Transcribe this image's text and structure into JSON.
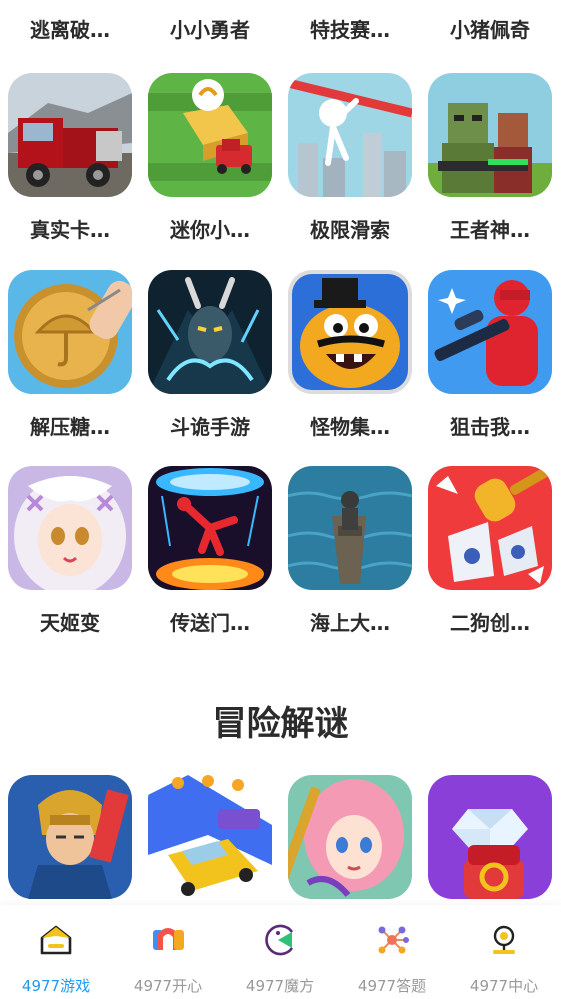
{
  "top_partial_labels": [
    "逃离破…",
    "小小勇者",
    "特技赛…",
    "小猪佩奇"
  ],
  "games": [
    {
      "name": "真实卡…",
      "icon": "truck-game-icon"
    },
    {
      "name": "迷你小…",
      "icon": "farm-truck-game-icon"
    },
    {
      "name": "极限滑索",
      "icon": "zipline-game-icon"
    },
    {
      "name": "王者神…",
      "icon": "blocky-soldier-game-icon"
    },
    {
      "name": "解压糖…",
      "icon": "candy-carving-game-icon"
    },
    {
      "name": "斗诡手游",
      "icon": "demon-warrior-game-icon"
    },
    {
      "name": "怪物集…",
      "icon": "monster-game-icon"
    },
    {
      "name": "狙击我…",
      "icon": "sniper-game-icon"
    },
    {
      "name": "天姬变",
      "icon": "anime-girl-game-icon"
    },
    {
      "name": "传送门…",
      "icon": "portal-game-icon"
    },
    {
      "name": "海上大…",
      "icon": "boat-game-icon"
    },
    {
      "name": "二狗创…",
      "icon": "hammer-vase-game-icon"
    }
  ],
  "section_title": "冒险解谜",
  "adventure_games": [
    {
      "icon": "hero-knight-game-icon"
    },
    {
      "icon": "taxi-runner-game-icon"
    },
    {
      "icon": "princess-game-icon"
    },
    {
      "icon": "diamond-ring-game-icon"
    }
  ],
  "tabbar": {
    "tabs": [
      {
        "label": "4977游戏",
        "icon": "home-icon",
        "active": true
      },
      {
        "label": "4977开心",
        "icon": "happy-logo-icon",
        "active": false
      },
      {
        "label": "4977魔方",
        "icon": "pacman-icon",
        "active": false
      },
      {
        "label": "4977答题",
        "icon": "molecule-icon",
        "active": false
      },
      {
        "label": "4977中心",
        "icon": "profile-icon",
        "active": false
      }
    ]
  },
  "colors": {
    "accent": "#1e9bf0",
    "text": "#2b2b2b",
    "inactive": "#999999"
  }
}
